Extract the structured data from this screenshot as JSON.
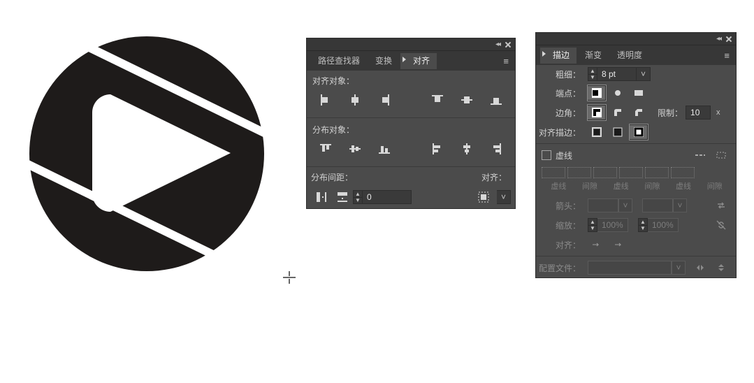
{
  "align_panel": {
    "tabs": {
      "pathfinder": "路径查找器",
      "transform": "变换",
      "align": "对齐"
    },
    "labels": {
      "align_objects": "对齐对象：",
      "distribute_objects": "分布对象：",
      "distribute_spacing": "分布间距：",
      "align_to": "对齐："
    },
    "spacing_value": "0"
  },
  "stroke_panel": {
    "tabs": {
      "stroke": "描边",
      "gradient": "渐变",
      "transparency": "透明度"
    },
    "labels": {
      "weight": "粗细：",
      "cap": "端点：",
      "corner": "边角：",
      "limit": "限制：",
      "align_stroke": "对齐描边：",
      "dashed": "虚线",
      "dash": "虚线",
      "gap": "间隙",
      "arrow": "箭头：",
      "scale": "缩放：",
      "dash_align": "对齐：",
      "profile": "配置文件："
    },
    "weight_value": "8 pt",
    "limit_value": "10",
    "limit_unit": "x",
    "scale_value_1": "100%",
    "scale_value_2": "100%"
  }
}
